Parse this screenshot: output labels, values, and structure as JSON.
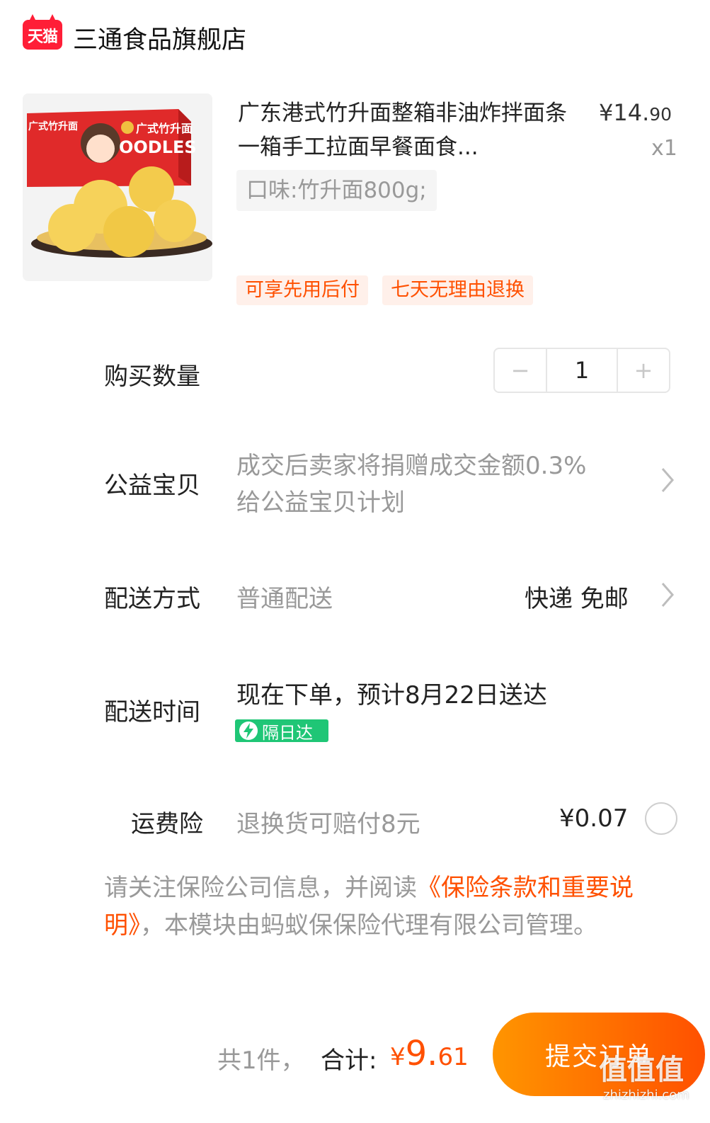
{
  "shop": {
    "logo_text": "天猫",
    "name": "三通食品旗舰店"
  },
  "product": {
    "title": "广东港式竹升面整箱非油炸拌面条一箱手工拉面早餐面食...",
    "price_symbol": "¥",
    "price_int": "14.",
    "price_cents": "90",
    "quantity_label": "x1",
    "sku": "口味:竹升面800g;",
    "image_text": {
      "brand": "广式竹升面",
      "word": "OODLES"
    },
    "tags": [
      "可享先用后付",
      "七天无理由退换"
    ]
  },
  "rows": {
    "quantity": {
      "label": "购买数量",
      "minus": "−",
      "value": "1",
      "plus": "+"
    },
    "charity": {
      "label": "公益宝贝",
      "line1": "成交后卖家将捐赠成交金额0.3%",
      "line2": "给公益宝贝计划"
    },
    "shipping_method": {
      "label": "配送方式",
      "value": "普通配送",
      "right": "快递 免邮"
    },
    "shipping_time": {
      "label": "配送时间",
      "value": "现在下单，预计8月22日送达",
      "badge": "隔日达"
    },
    "insurance": {
      "label": "运费险",
      "value": "退换货可赔付8元",
      "price": "¥0.07"
    }
  },
  "notice": {
    "before": "请关注保险公司信息，并阅读",
    "link": "《保险条款和重要说明》",
    "after": "，本模块由蚂蚁保保险代理有限公司管理。"
  },
  "footer": {
    "count": "共1件，",
    "total_label": "合计:",
    "total_symbol": "¥",
    "total_int": "9.",
    "total_dec": "61",
    "submit_label": "提交订单"
  },
  "watermark": {
    "main": "值值值",
    "sub": "zhizhizhi.com"
  },
  "colors": {
    "accent": "#ff5000",
    "tmall_red": "#ff1e37",
    "badge_green": "#1fc676",
    "muted": "#999999"
  }
}
